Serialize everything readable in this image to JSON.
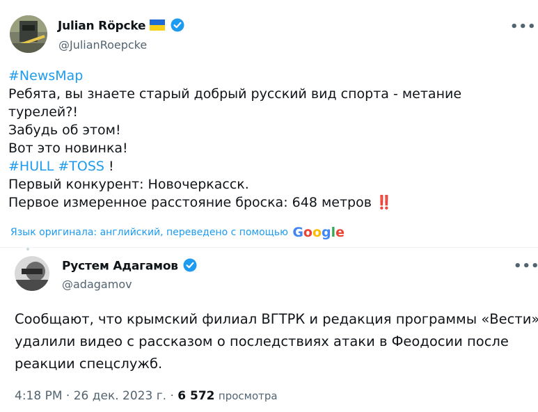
{
  "tweet": {
    "author_name": "Julian Röpcke",
    "author_handle": "@JulianRoepcke",
    "hashtag_top": "#NewsMap",
    "lines": [
      "Ребята, вы знаете старый добрый русский вид спорта - метание",
      "турелей?!",
      "Забудь об этом!",
      "Вот это новинка!"
    ],
    "hashtag_hull": "#HULL",
    "hashtag_toss": "#TOSS",
    "after_tags": " !",
    "line_competitor": "Первый конкурент: Новочеркасск.",
    "line_distance": "Первое измеренное расстояние броска: 648 метров",
    "exclamation_emoji": "‼️",
    "translation_note": "Язык оригинала: английский, переведено с помощью",
    "google_logo": "Google",
    "more_label": "•••"
  },
  "quoted": {
    "author_name": "Рустем Адагамов",
    "author_handle": "@adagamov",
    "text_lines": [
      "Сообщают, что крымский филиал ВГТРК и редакция программы «Вести»",
      "удалили видео с рассказом о последствиях атаки в Феодосии после",
      "реакции спецслужб."
    ],
    "more_label": "•••"
  },
  "meta": {
    "time": "4:18 PM",
    "sep1": " · ",
    "date": "26 дек. 2023 г.",
    "sep2": " · ",
    "views_count": "6 572",
    "views_label": "просмотра"
  },
  "colors": {
    "link": "#1d9bf0",
    "secondary": "#536471",
    "verified": "#1d9bf0"
  },
  "icons": {
    "flag": "ukraine-flag-icon",
    "verified": "verified-badge-icon"
  }
}
